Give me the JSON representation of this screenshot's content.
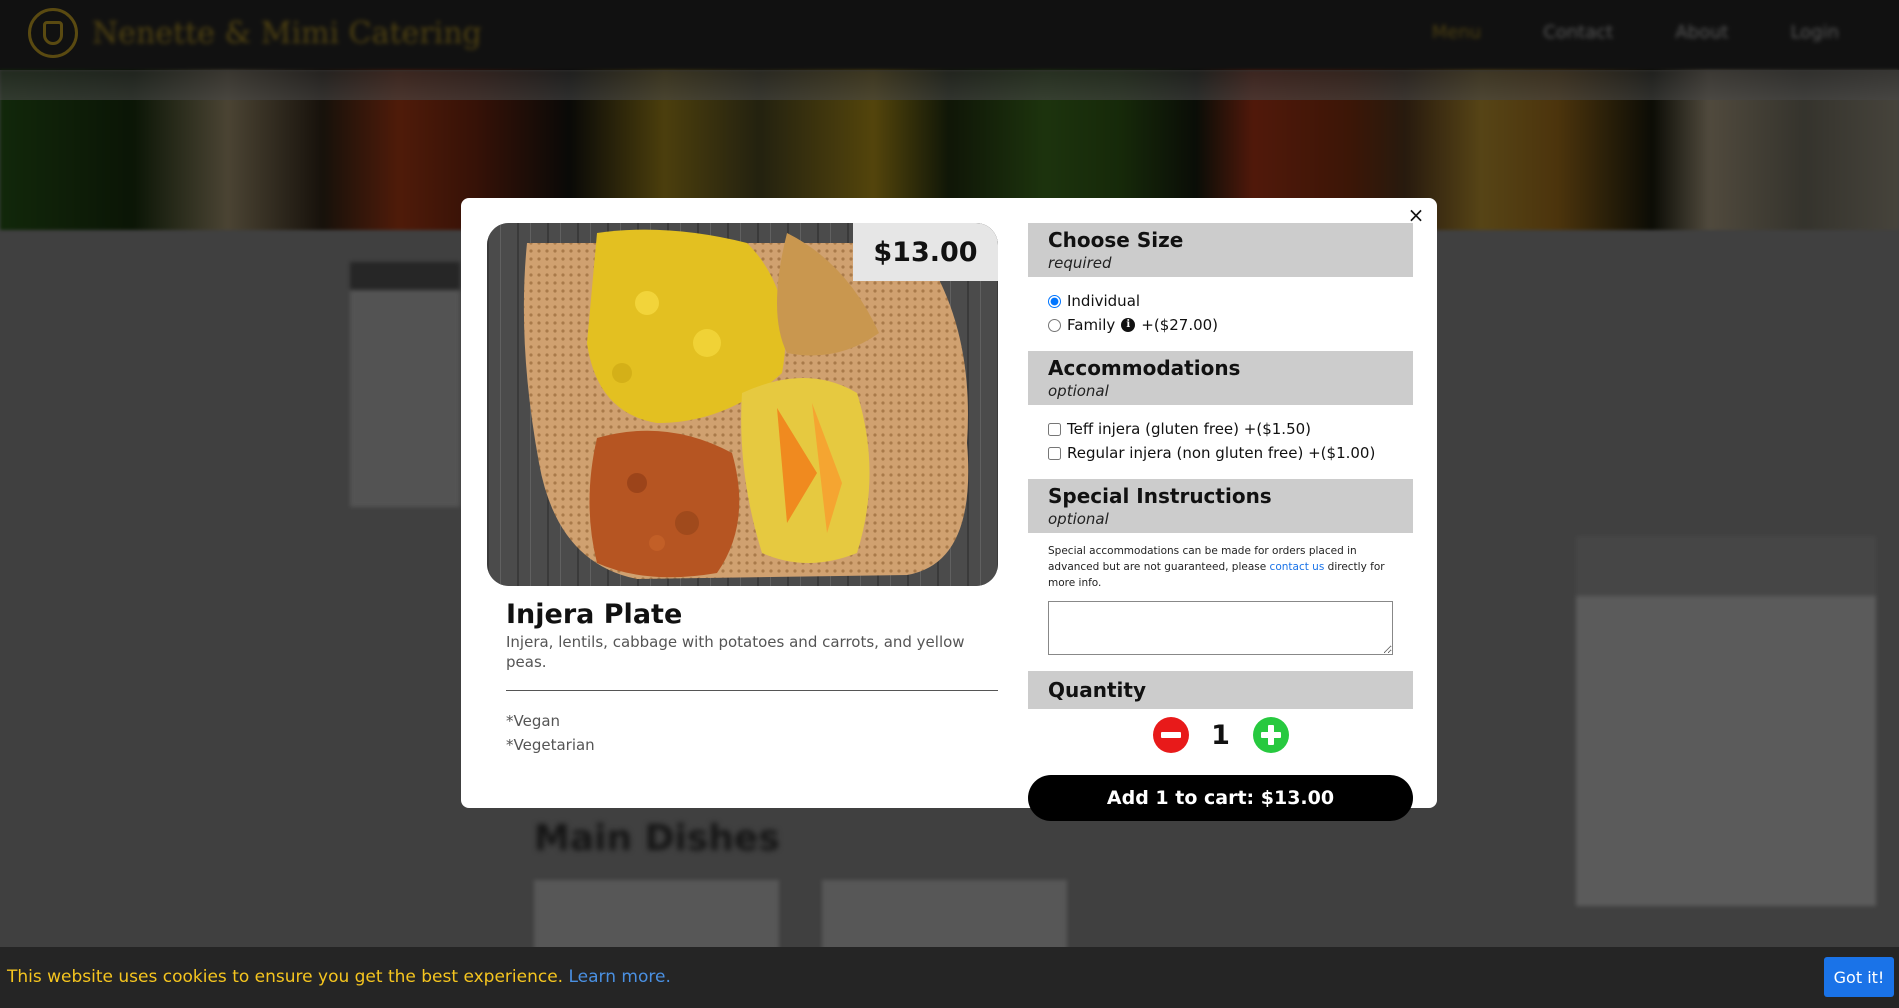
{
  "background": {
    "brand": "Nenette & Mimi Catering",
    "nav_items": [
      "Menu",
      "Contact",
      "About",
      "Login"
    ],
    "main_section_title": "Main Dishes"
  },
  "modal": {
    "close_label": "×",
    "dish": {
      "price": "$13.00",
      "title": "Injera Plate",
      "description": "Injera, lentils, cabbage with potatoes and carrots, and yellow peas.",
      "tags": [
        "*Vegan",
        "*Vegetarian"
      ]
    },
    "size": {
      "title": "Choose Size",
      "subtitle": "required",
      "options": [
        {
          "label": "Individual",
          "price": "",
          "selected": true
        },
        {
          "label": "Family",
          "price": "+($27.00)",
          "selected": false
        }
      ],
      "info_icon": "info-icon"
    },
    "accommodations": {
      "title": "Accommodations",
      "subtitle": "optional",
      "options": [
        {
          "label": "Teff injera (gluten free)",
          "price": "+($1.50)",
          "checked": false
        },
        {
          "label": "Regular injera (non gluten free)",
          "price": "+($1.00)",
          "checked": false
        }
      ]
    },
    "instructions": {
      "title": "Special Instructions",
      "subtitle": "optional",
      "note_before": "Special accommodations can be made for orders placed in advanced but are not guaranteed, please ",
      "note_link": "contact us",
      "note_after": " directly for more info.",
      "value": ""
    },
    "quantity": {
      "title": "Quantity",
      "value": "1"
    },
    "add_to_cart_label": "Add 1 to cart: $13.00"
  },
  "cookie": {
    "message": "This website uses cookies to ensure you get the best experience. ",
    "learn_more": "Learn more.",
    "accept_label": "Got it!"
  },
  "colors": {
    "minus_button": "#e81a1a",
    "plus_button": "#27c93f",
    "cookie_text": "#f5c51f",
    "link": "#1a73e8",
    "section_header": "#cccccc"
  }
}
